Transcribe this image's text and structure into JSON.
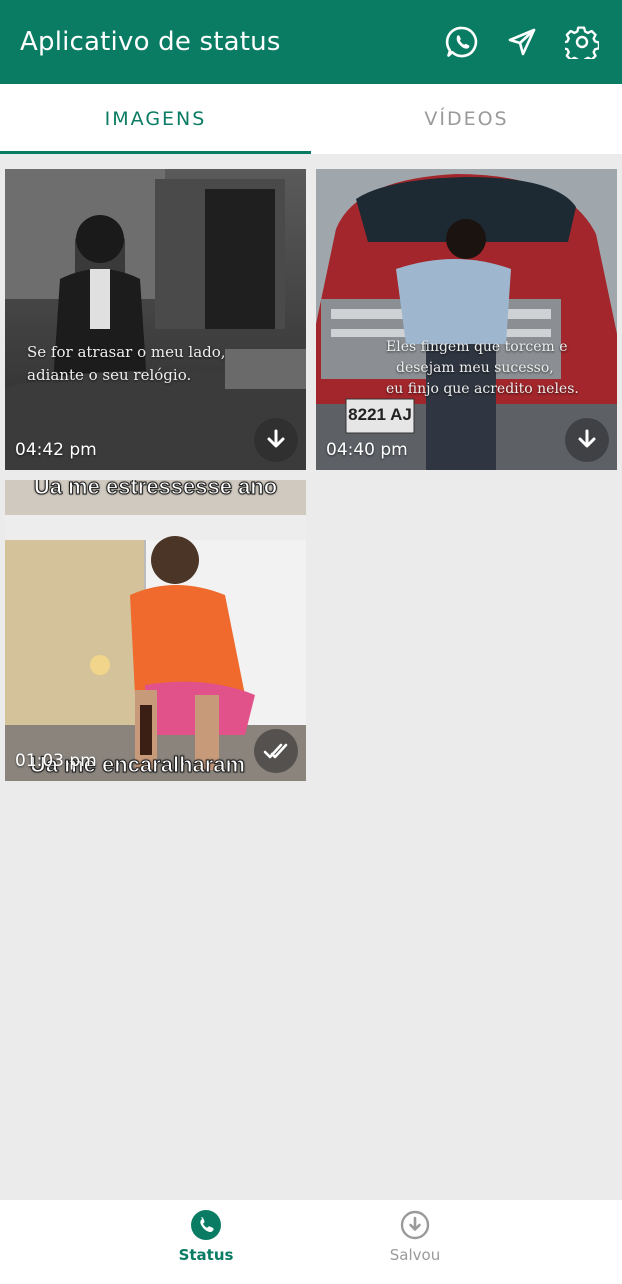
{
  "appbar": {
    "title": "Aplicativo de status",
    "actions": [
      {
        "icon": "whatsapp-icon"
      },
      {
        "icon": "send-icon"
      },
      {
        "icon": "gear-icon"
      }
    ]
  },
  "tabs": [
    {
      "label": "IMAGENS",
      "active": true
    },
    {
      "label": "VÍDEOS",
      "active": false
    }
  ],
  "tiles": [
    {
      "time": "04:42 pm",
      "caption_lines": [
        "Se for atrasar o meu lado,",
        "adiante o seu relógio."
      ],
      "action_icon": "download-icon"
    },
    {
      "time": "04:40 pm",
      "caption_lines": [
        "Eles fingem que torcem e",
        "desejam meu sucesso,",
        "eu finjo que acredito neles."
      ],
      "plate": "8221 AJ",
      "action_icon": "download-icon"
    },
    {
      "time": "01:03 pm",
      "top_text": "Ua me estressesse ano",
      "bottom_text": "Ua me encaralharam",
      "action_icon": "double-check-icon"
    }
  ],
  "bottomnav": [
    {
      "label": "Status",
      "icon": "phone-icon",
      "active": true
    },
    {
      "label": "Salvou",
      "icon": "download-circle-icon",
      "active": false
    }
  ],
  "colors": {
    "primary": "#0a7c63",
    "background": "#ebebeb"
  }
}
